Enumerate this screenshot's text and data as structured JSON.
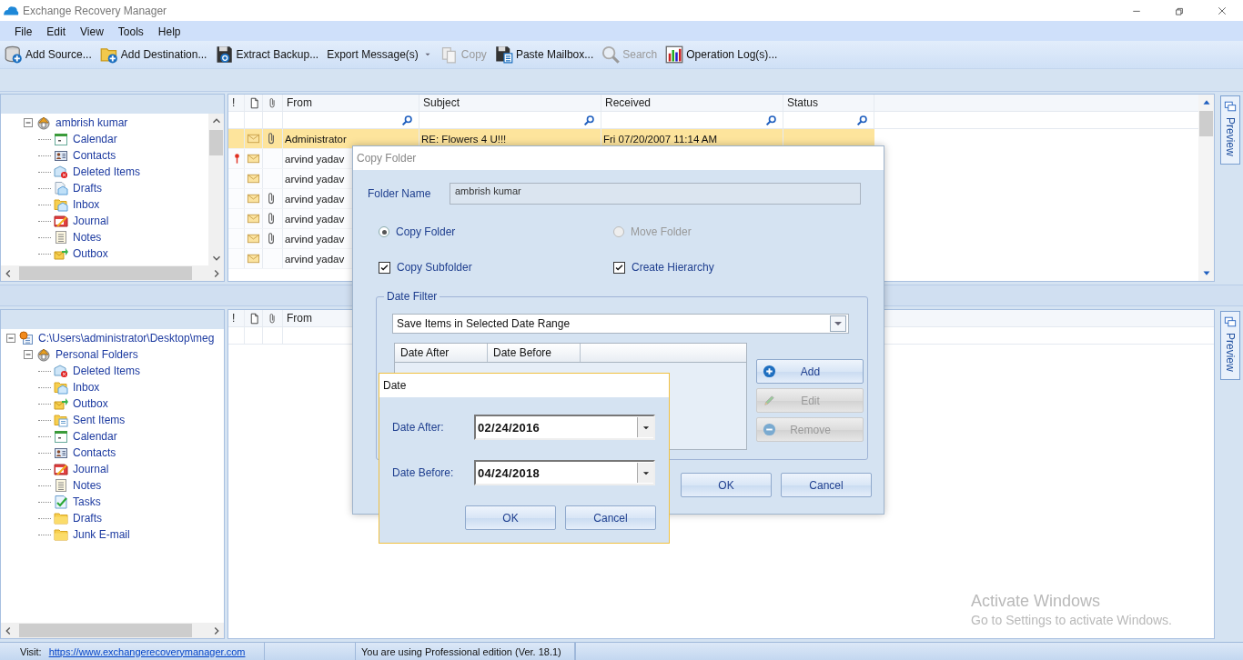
{
  "window": {
    "title": "Exchange Recovery Manager"
  },
  "menu": [
    "File",
    "Edit",
    "View",
    "Tools",
    "Help"
  ],
  "toolbar": [
    {
      "label": "Add Source...",
      "kind": "button",
      "disabled": false
    },
    {
      "label": "Add Destination...",
      "kind": "button",
      "disabled": false
    },
    {
      "label": "Extract Backup...",
      "kind": "button",
      "disabled": false
    },
    {
      "label": "Export Message(s)",
      "kind": "dropdown",
      "disabled": false
    },
    {
      "label": "Copy",
      "kind": "button",
      "disabled": true
    },
    {
      "label": "Paste Mailbox...",
      "kind": "button",
      "disabled": false
    },
    {
      "label": "Search",
      "kind": "button",
      "disabled": true
    },
    {
      "label": "Operation Log(s)...",
      "kind": "button",
      "disabled": false
    }
  ],
  "source_tree": [
    {
      "label": "ambrish kumar",
      "kind": "mailbox",
      "expanded": true,
      "children": [
        {
          "label": "Calendar",
          "kind": "calendar"
        },
        {
          "label": "Contacts",
          "kind": "contacts"
        },
        {
          "label": "Deleted Items",
          "kind": "deleted"
        },
        {
          "label": "Drafts",
          "kind": "drafts"
        },
        {
          "label": "Inbox",
          "kind": "inbox"
        },
        {
          "label": "Journal",
          "kind": "journal"
        },
        {
          "label": "Notes",
          "kind": "notes"
        },
        {
          "label": "Outbox",
          "kind": "outbox"
        }
      ]
    }
  ],
  "message_list": {
    "columns": [
      {
        "kind": "text",
        "label": "!"
      },
      {
        "kind": "page"
      },
      {
        "kind": "attachment"
      },
      {
        "kind": "text",
        "label": "From",
        "filter": true
      },
      {
        "kind": "text",
        "label": "Subject",
        "filter": true
      },
      {
        "kind": "text",
        "label": "Received",
        "filter": true
      },
      {
        "kind": "text",
        "label": "Status",
        "filter": true
      }
    ],
    "rows": [
      {
        "selected": true,
        "important": false,
        "attachment": true,
        "from": "Administrator",
        "subject": "RE: Flowers 4 U!!!",
        "received": "Fri 07/20/2007 11:14 AM"
      },
      {
        "selected": false,
        "important": true,
        "attachment": false,
        "from": "arvind yadav"
      },
      {
        "selected": false,
        "important": false,
        "attachment": false,
        "from": "arvind yadav"
      },
      {
        "selected": false,
        "important": false,
        "attachment": true,
        "from": "arvind yadav"
      },
      {
        "selected": false,
        "important": false,
        "attachment": true,
        "from": "arvind yadav"
      },
      {
        "selected": false,
        "important": false,
        "attachment": true,
        "from": "arvind yadav"
      },
      {
        "selected": false,
        "important": false,
        "attachment": false,
        "from": "arvind yadav"
      }
    ],
    "preview_tab": "Preview"
  },
  "destination_tree": [
    {
      "label": "C:\\Users\\administrator\\Desktop\\meg",
      "kind": "pst",
      "expanded": true,
      "children": [
        {
          "label": "Personal Folders",
          "kind": "mailbox",
          "expanded": true,
          "children": [
            {
              "label": "Deleted Items",
              "kind": "deleted"
            },
            {
              "label": "Inbox",
              "kind": "inbox"
            },
            {
              "label": "Outbox",
              "kind": "outbox"
            },
            {
              "label": "Sent Items",
              "kind": "sent"
            },
            {
              "label": "Calendar",
              "kind": "calendar"
            },
            {
              "label": "Contacts",
              "kind": "contacts"
            },
            {
              "label": "Journal",
              "kind": "journal"
            },
            {
              "label": "Notes",
              "kind": "notes"
            },
            {
              "label": "Tasks",
              "kind": "tasks"
            },
            {
              "label": "Drafts",
              "kind": "folder"
            },
            {
              "label": "Junk E-mail",
              "kind": "folder"
            }
          ]
        }
      ]
    }
  ],
  "destination_list": {
    "columns": [
      {
        "kind": "text",
        "label": "!"
      },
      {
        "kind": "page"
      },
      {
        "kind": "attachment"
      },
      {
        "kind": "text",
        "label": "From"
      }
    ],
    "preview_tab": "Preview"
  },
  "copy_folder_dialog": {
    "title": "Copy Folder",
    "folder_name": {
      "label": "Folder Name",
      "value": "ambrish kumar",
      "disabled": true
    },
    "options": [
      {
        "label": "Copy Folder",
        "selected": true,
        "disabled": false
      },
      {
        "label": "Move Folder",
        "selected": false,
        "disabled": true
      }
    ],
    "checkboxes": [
      {
        "label": "Copy Subfolder",
        "checked": true
      },
      {
        "label": "Create Hierarchy",
        "checked": true
      }
    ],
    "date_filter": {
      "legend": "Date Filter",
      "mode": "Save Items in Selected Date Range",
      "columns": [
        "Date After",
        "Date Before"
      ],
      "buttons": [
        {
          "label": "Add",
          "disabled": false
        },
        {
          "label": "Edit",
          "disabled": true
        },
        {
          "label": "Remove",
          "disabled": true
        }
      ]
    },
    "buttons": [
      "OK",
      "Cancel"
    ]
  },
  "date_dialog": {
    "title": "Date",
    "fields": [
      {
        "label": "Date After:",
        "value": "02/24/2016"
      },
      {
        "label": "Date Before:",
        "value": "04/24/2018"
      }
    ],
    "buttons": [
      "OK",
      "Cancel"
    ]
  },
  "status_bar": {
    "visit_label": "Visit:",
    "link": "https://www.exchangerecoverymanager.com",
    "edition": "You are using Professional edition (Ver. 18.1)"
  },
  "os_notice": {
    "title": "Activate Windows",
    "text": "Go to Settings to activate Windows."
  }
}
